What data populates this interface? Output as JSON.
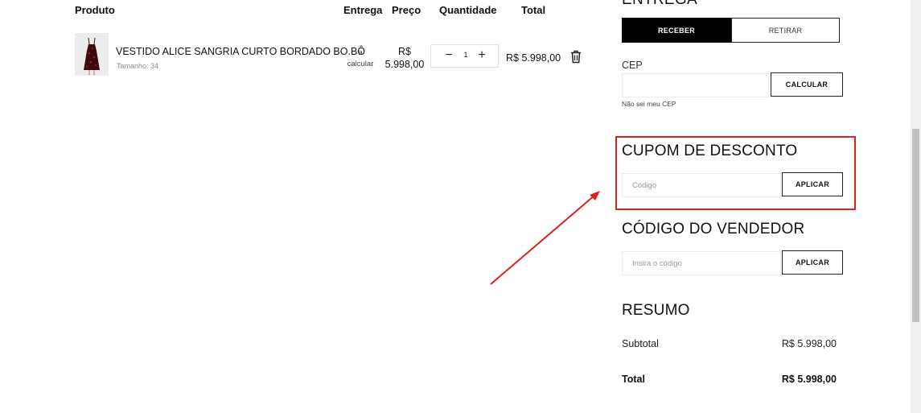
{
  "cart": {
    "headers": {
      "product": "Produto",
      "shipping": "Entrega",
      "price": "Preço",
      "quantity": "Quantidade",
      "total": "Total"
    },
    "items": [
      {
        "name": "VESTIDO ALICE SANGRIA CURTO BORDADO BO.BÔ",
        "size_label": "Tamanho: 34",
        "shipping_line1": "a",
        "shipping_line2": "calcular",
        "price_line1": "R$",
        "price_line2": "5.998,00",
        "quantity": "1",
        "minus": "−",
        "plus": "+",
        "total": "R$ 5.998,00",
        "remove_icon": "trash-icon",
        "thumbnail_icon": "dress-product-image"
      }
    ]
  },
  "delivery": {
    "title": "ENTREGA",
    "options": [
      "RECEBER",
      "RETIRAR"
    ],
    "selected": "RECEBER",
    "cep_label": "CEP",
    "cep_value": "",
    "calculate_button": "CALCULAR",
    "unknown_cep_link": "Não sei meu CEP"
  },
  "coupon": {
    "title": "CUPOM DE DESCONTO",
    "placeholder": "Código",
    "button": "APLICAR"
  },
  "seller": {
    "title": "CÓDIGO DO VENDEDOR",
    "placeholder": "Insira o código",
    "button": "APLICAR"
  },
  "summary": {
    "title": "RESUMO",
    "subtotal_label": "Subtotal",
    "subtotal_value": "R$ 5.998,00",
    "total_label": "Total",
    "total_value": "R$ 5.998,00"
  },
  "annotation": {
    "highlight_color": "#e0201e",
    "arrow_color": "#e0201e"
  },
  "colors": {
    "primary": "#000000",
    "text": "#111111",
    "border_light": "#ececec"
  }
}
